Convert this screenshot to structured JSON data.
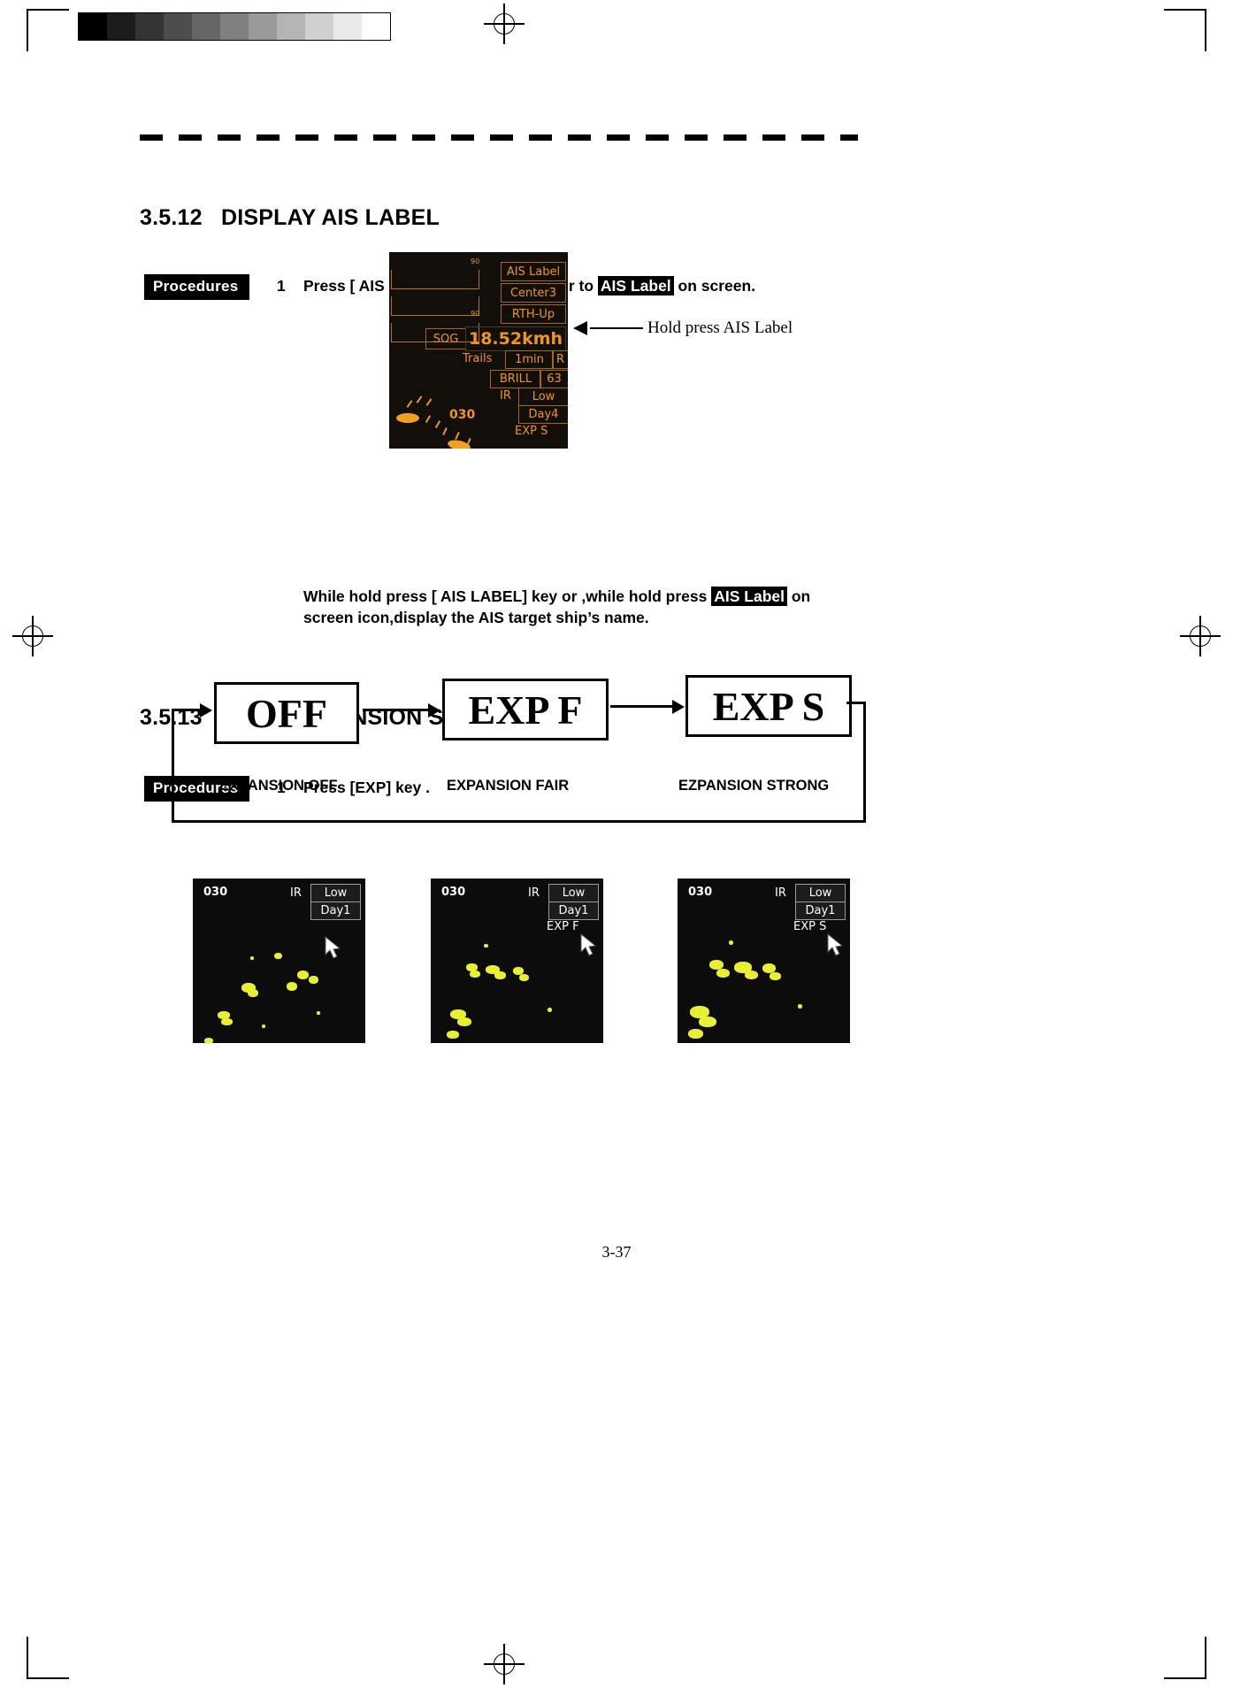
{
  "page": {
    "folio": "3-37"
  },
  "sections": [
    {
      "number": "3.5.12",
      "title": "DISPLAY AIS LABEL",
      "procedures_tag": "Procedures",
      "step_number": "1",
      "step_pre": "Press [ AIS LABEL] key or set cursor to ",
      "step_highlight": "AIS Label",
      "step_post": " on screen.",
      "callout": "Hold press AIS Label",
      "note_line1_pre": "While hold press [ AIS LABEL] key or ,while hold press ",
      "note_line1_highlight": "AIS Label",
      "note_line1_post": " on",
      "note_line2": "screen icon,display the AIS target ship’s name."
    },
    {
      "number": "3.5.13",
      "title": "ECHO EXPANSION SWITCH",
      "procedures_tag": "Procedures",
      "step_number": "1",
      "step_text": "Press [EXP] key ."
    }
  ],
  "console": {
    "scale_top": "90",
    "scale_bottom": "90",
    "ais_label": "AIS  Label",
    "center": "Center3",
    "heading_mode": "RTH-Up",
    "sog_tag": "SOG",
    "sog_value": "18.52kmh",
    "trails_tag": "Trails",
    "trails_value": "1min",
    "trails_mode": "R",
    "brill_tag": "BRILL",
    "brill_value": "63",
    "ir_tag": "IR",
    "ir_value": "Low",
    "day_value": "Day4",
    "exp_value": "EXP  S",
    "bearing": "030",
    "accent_color": "#f0951e",
    "background_color": "#120f0b"
  },
  "flow": {
    "boxes": [
      {
        "label": "OFF",
        "caption": "EXPANSION OFF"
      },
      {
        "label": "EXP F",
        "caption": "EXPANSION   FAIR"
      },
      {
        "label": "EXP S",
        "caption": "EZPANSION   STRONG"
      }
    ]
  },
  "echo_samples": [
    {
      "bearing": "030",
      "ir_tag": "IR",
      "ir_value": "Low",
      "day_value": "Day1",
      "exp_value": ""
    },
    {
      "bearing": "030",
      "ir_tag": "IR",
      "ir_value": "Low",
      "day_value": "Day1",
      "exp_value": "EXP  F"
    },
    {
      "bearing": "030",
      "ir_tag": "IR",
      "ir_value": "Low",
      "day_value": "Day1",
      "exp_value": "EXP  S"
    }
  ],
  "greyscale_steps": [
    "#000000",
    "#1c1c1c",
    "#343434",
    "#4d4d4d",
    "#666666",
    "#808080",
    "#9a9a9a",
    "#b5b5b5",
    "#d0d0d0",
    "#e9e9e9",
    "#ffffff"
  ]
}
